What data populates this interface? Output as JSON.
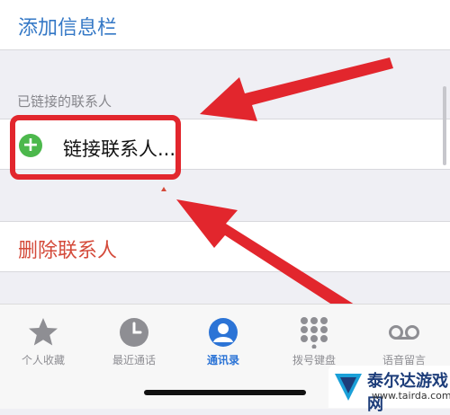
{
  "header": {
    "add_info_bar": "添加信息栏"
  },
  "linked_section": {
    "title": "已链接的联系人",
    "link_label": "链接联系人...",
    "plus_glyph": "+"
  },
  "actions": {
    "delete_contact": "删除联系人"
  },
  "tabs": [
    {
      "label": "个人收藏",
      "icon": "star-icon"
    },
    {
      "label": "最近通话",
      "icon": "clock-icon"
    },
    {
      "label": "通讯录",
      "icon": "contacts-icon",
      "active": true
    },
    {
      "label": "拨号键盘",
      "icon": "keypad-icon"
    },
    {
      "label": "语音留言",
      "icon": "voicemail-icon"
    }
  ],
  "watermark": {
    "name": "泰尔达游戏网",
    "url": "www.tairda.com"
  },
  "colors": {
    "accent": "#3478c6",
    "destructive": "#d44a3a",
    "highlight": "#e2262d",
    "add_green": "#4cb84c"
  }
}
